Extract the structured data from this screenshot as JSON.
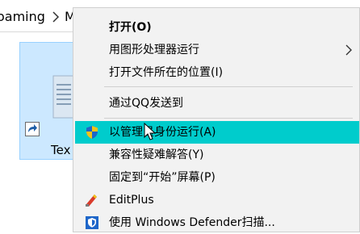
{
  "address_bar": {
    "crumb_roaming": "oaming",
    "crumb_next": "M"
  },
  "file_item": {
    "label": "Tex",
    "icon": "document-icon",
    "overlay_icon": "shortcut-arrow-icon"
  },
  "context_menu": {
    "items": [
      {
        "label": "打开(O)",
        "bold": true,
        "icon": null,
        "submenu": false
      },
      {
        "label": "用图形处理器运行",
        "bold": false,
        "icon": null,
        "submenu": true
      },
      {
        "label": "打开文件所在的位置(I)",
        "bold": false,
        "icon": null,
        "submenu": false
      },
      {
        "label": "通过QQ发送到",
        "bold": false,
        "icon": null,
        "submenu": false
      },
      {
        "label": "以管理员身份运行(A)",
        "bold": false,
        "icon": "shield-icon",
        "submenu": false,
        "highlighted": true
      },
      {
        "label": "兼容性疑难解答(Y)",
        "bold": false,
        "icon": null,
        "submenu": false
      },
      {
        "label": "固定到“开始”屏幕(P)",
        "bold": false,
        "icon": null,
        "submenu": false
      },
      {
        "label": "EditPlus",
        "bold": false,
        "icon": "editplus-icon",
        "submenu": false
      },
      {
        "label": "使用 Windows Defender扫描...",
        "bold": false,
        "icon": "windows-defender-icon",
        "submenu": false
      }
    ]
  },
  "colors": {
    "menu_background": "#f2f2f2",
    "highlight": "#00cccc",
    "selection_tile": "#cce8ff",
    "separator": "#cfcfcf"
  }
}
